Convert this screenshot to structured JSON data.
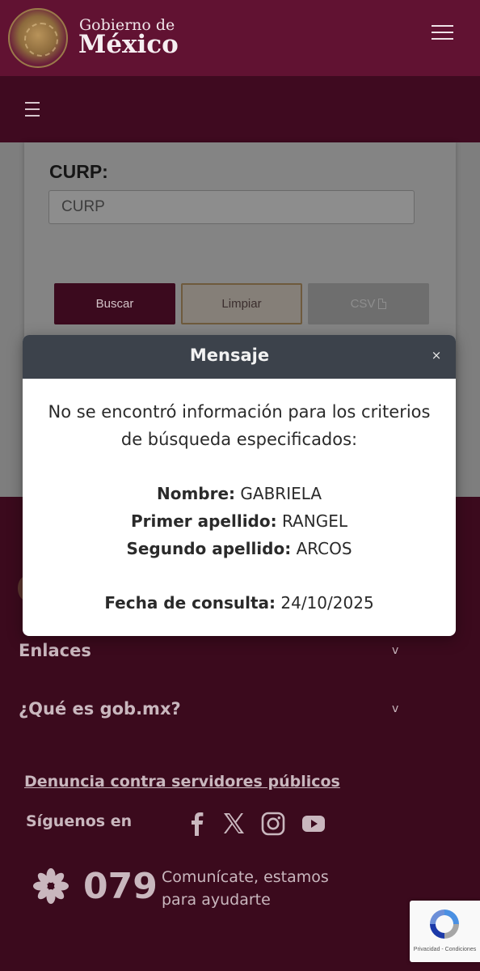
{
  "header": {
    "brand_line1": "Gobierno de",
    "brand_line2": "México",
    "seal_icon": "coat-of-arms-seal",
    "menu_icon": "hamburger-menu-icon"
  },
  "subbar": {
    "menu_icon": "hamburger-menu-icon"
  },
  "form": {
    "curp_label": "CURP:",
    "curp_placeholder": "CURP",
    "curp_value": "",
    "buttons": {
      "search": "Buscar",
      "clear": "Limpiar",
      "csv": "CSV"
    }
  },
  "modal": {
    "title": "Mensaje",
    "close": "×",
    "message": "No se encontró información para los criterios de búsqueda especificados:",
    "fields": {
      "nombre_label": "Nombre:",
      "nombre_value": "GABRIELA",
      "primer_label": "Primer apellido:",
      "primer_value": "RANGEL",
      "segundo_label": "Segundo apellido:",
      "segundo_value": "ARCOS",
      "fecha_label": "Fecha de consulta:",
      "fecha_value": "24/10/2025"
    }
  },
  "footer": {
    "accordions": [
      {
        "label": "Enlaces",
        "chevron": "v"
      },
      {
        "label": "¿Qué es gob.mx?",
        "chevron": "v"
      }
    ],
    "denuncia_link": "Denuncia contra servidores públicos",
    "follow_label": "Síguenos en",
    "social_icons": [
      "facebook-icon",
      "x-icon",
      "instagram-icon",
      "youtube-icon"
    ],
    "phone_number": "079",
    "phone_text": "Comunícate, estamos para ayudarte"
  },
  "recaptcha": {
    "text": "Privacidad - Condiciones"
  },
  "colors": {
    "brand_maroon": "#611232",
    "footer_bg": "#3b0a1d",
    "modal_header": "#3c424b",
    "overlay": "#7e7e7e"
  }
}
